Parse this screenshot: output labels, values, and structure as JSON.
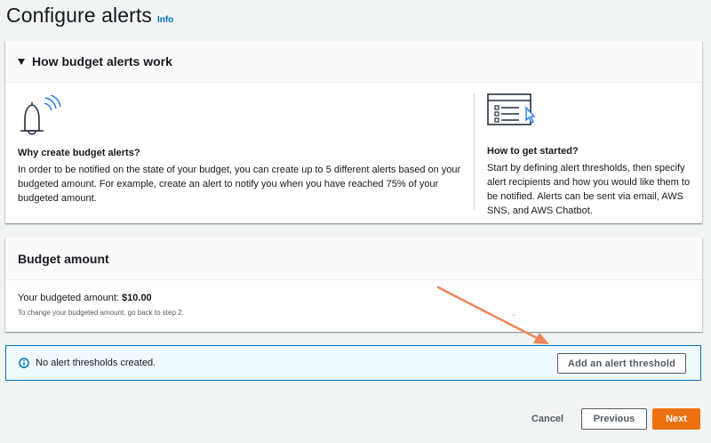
{
  "page": {
    "title": "Configure alerts",
    "info_link": "Info"
  },
  "how_it_works": {
    "title": "How budget alerts work",
    "expanded": true,
    "left": {
      "icon": "bell-icon",
      "heading": "Why create budget alerts?",
      "body": "In order to be notified on the state of your budget, you can create up to 5 different alerts based on your budgeted amount. For example, create an alert to notify you when you have reached 75% of your budgeted amount."
    },
    "right": {
      "icon": "browser-checklist-icon",
      "heading": "How to get started?",
      "body": "Start by defining alert thresholds, then specify alert recipients and how you would like them to be notified. Alerts can be sent via email, AWS SNS, and AWS Chatbot."
    }
  },
  "budget_amount": {
    "title": "Budget amount",
    "label": "Your budgeted amount:",
    "value": "$10.00",
    "hint": "To change your budgeted amount, go back to step 2."
  },
  "alerts": {
    "empty_message": "No alert thresholds created.",
    "add_button": "Add an alert threshold"
  },
  "footer": {
    "cancel": "Cancel",
    "previous": "Previous",
    "next": "Next"
  },
  "colors": {
    "primary_button": "#ec7211",
    "info_blue": "#0073bb",
    "annotation_arrow": "#f0865a"
  }
}
